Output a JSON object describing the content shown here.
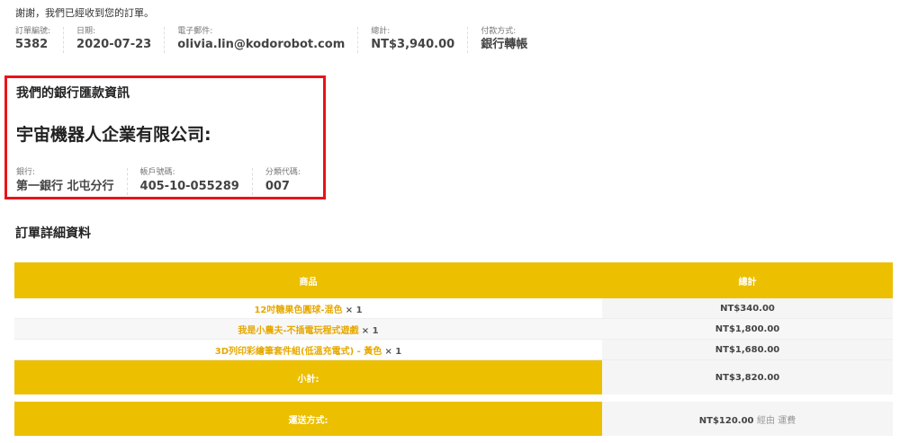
{
  "thanks_message": "謝謝，我們已經收到您的訂單。",
  "overview": [
    {
      "label": "訂單編號:",
      "value": "5382"
    },
    {
      "label": "日期:",
      "value": "2020-07-23"
    },
    {
      "label": "電子郵件:",
      "value": "olivia.lin@kodorobot.com"
    },
    {
      "label": "總計:",
      "value": "NT$3,940.00"
    },
    {
      "label": "付款方式:",
      "value": "銀行轉帳"
    }
  ],
  "bank": {
    "title": "我們的銀行匯款資訊",
    "company": "宇宙機器人企業有限公司:",
    "details": [
      {
        "label": "銀行:",
        "value": "第一銀行 北屯分行"
      },
      {
        "label": "帳戶號碼:",
        "value": "405-10-055289"
      },
      {
        "label": "分類代碼:",
        "value": "007"
      }
    ]
  },
  "order_details": {
    "title": "訂單詳細資料",
    "headers": {
      "product": "商品",
      "total": "總計"
    },
    "items": [
      {
        "name": "12吋糖果色圓球-混色",
        "qty": "× 1",
        "total": "NT$340.00"
      },
      {
        "name": "我是小農夫-不插電玩程式遊戲",
        "qty": "× 1",
        "total": "NT$1,800.00"
      },
      {
        "name": "3D列印彩繪筆套件組(低溫充電式) - 黃色",
        "qty": "× 1",
        "total": "NT$1,680.00"
      }
    ],
    "subtotal": {
      "label": "小計:",
      "value": "NT$3,820.00"
    },
    "shipping": {
      "label": "運送方式:",
      "value": "NT$120.00",
      "via": "經由 運費"
    }
  },
  "colors": {
    "accent": "#ecbf00",
    "highlight_border": "#e8141b",
    "link": "#e7a800"
  }
}
